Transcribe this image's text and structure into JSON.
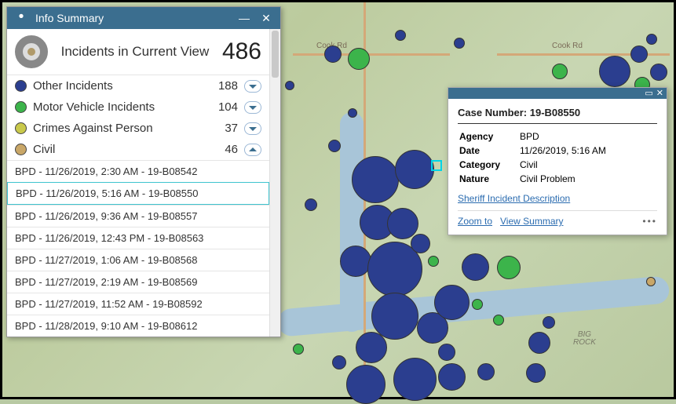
{
  "panel": {
    "title": "Info Summary",
    "summary_label": "Incidents in Current View",
    "summary_count": "486",
    "categories": [
      {
        "label": "Other Incidents",
        "count": "188",
        "color": "#2b3e8f",
        "expanded": false
      },
      {
        "label": "Motor Vehicle Incidents",
        "count": "104",
        "color": "#3cb44b",
        "expanded": false
      },
      {
        "label": "Crimes Against Person",
        "count": "37",
        "color": "#c9c94b",
        "expanded": false
      },
      {
        "label": "Civil",
        "count": "46",
        "color": "#c9a768",
        "expanded": true
      }
    ],
    "details": [
      "BPD - 11/26/2019, 2:30 AM - 19-B08542",
      "BPD - 11/26/2019, 5:16 AM - 19-B08550",
      "BPD - 11/26/2019, 9:36 AM - 19-B08557",
      "BPD - 11/26/2019, 12:43 PM - 19-B08563",
      "BPD - 11/27/2019, 1:06 AM - 19-B08568",
      "BPD - 11/27/2019, 2:19 AM - 19-B08569",
      "BPD - 11/27/2019, 11:52 AM - 19-B08592",
      "BPD - 11/28/2019, 9:10 AM - 19-B08612"
    ],
    "selected_detail_index": 1
  },
  "popup": {
    "title": "Case Number: 19-B08550",
    "rows": [
      {
        "k": "Agency",
        "v": "BPD"
      },
      {
        "k": "Date",
        "v": "11/26/2019, 5:16 AM"
      },
      {
        "k": "Category",
        "v": "Civil"
      },
      {
        "k": "Nature",
        "v": "Civil Problem"
      }
    ],
    "link": "Sheriff Incident Description",
    "zoom": "Zoom to",
    "view": "View Summary"
  },
  "map_labels": {
    "cook1": "Cook Rd",
    "cook2": "Cook Rd",
    "bigrock": "BIG\nROCK"
  },
  "colors": {
    "blue": "#2b3e8f",
    "green": "#3cb44b",
    "olive": "#c9c94b",
    "tan": "#c9a768"
  }
}
